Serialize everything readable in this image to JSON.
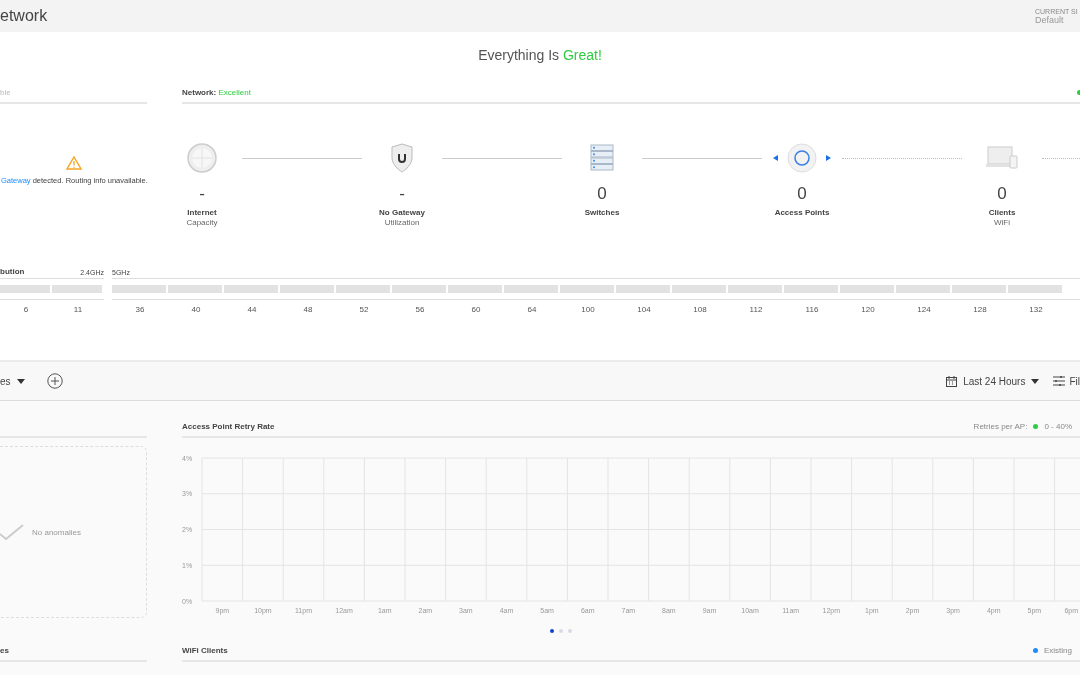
{
  "header": {
    "title": "etwork",
    "site_label": "CURRENT SI",
    "site_value": "Default"
  },
  "status": {
    "text": "Everything Is",
    "highlight": "Great!"
  },
  "left_panel": {
    "title": "ble",
    "message_link": "Gateway",
    "message": "detected. Routing info unavailable."
  },
  "network": {
    "label": "Network:",
    "rating": "Excellent"
  },
  "topology": [
    {
      "kind": "internet",
      "value": "-",
      "label": "Internet",
      "sublabel": "Capacity",
      "wireless": false
    },
    {
      "kind": "gateway",
      "value": "-",
      "label": "No Gateway",
      "sublabel": "Utilization",
      "wireless": false
    },
    {
      "kind": "switch",
      "value": "0",
      "label": "Switches",
      "wireless": false
    },
    {
      "kind": "access_point",
      "value": "0",
      "label": "Access Points",
      "wireless": true
    },
    {
      "kind": "client",
      "value": "0",
      "label": "Clients",
      "sublabel": "WiFi",
      "wireless": true
    }
  ],
  "channel_distribution": {
    "title": "bution",
    "bands": [
      {
        "name": "2.4GHz",
        "channels": [
          "6",
          "11"
        ]
      },
      {
        "name": "5GHz",
        "channels": [
          "36",
          "40",
          "44",
          "48",
          "52",
          "56",
          "60",
          "64",
          "100",
          "104",
          "108",
          "112",
          "116",
          "120",
          "124",
          "128",
          "132"
        ]
      }
    ]
  },
  "toolbar": {
    "view": "es",
    "range": "Last 24 Hours",
    "filter": "Fil"
  },
  "anomalies": {
    "message": "No anomalies"
  },
  "retry_chart": {
    "title": "Access Point Retry Rate",
    "legend_label": "Retries per AP:",
    "chart_data": {
      "type": "line",
      "categories": [
        "9pm",
        "10pm",
        "11pm",
        "12am",
        "1am",
        "2am",
        "3am",
        "4am",
        "5am",
        "6am",
        "7am",
        "8am",
        "9am",
        "10am",
        "11am",
        "12pm",
        "1pm",
        "2pm",
        "3pm",
        "4pm",
        "5pm",
        "6pm"
      ],
      "series": [
        {
          "name": "0 - 40%",
          "color": "#2ecc40",
          "values": [
            null,
            null,
            null,
            null,
            null,
            null,
            null,
            null,
            null,
            null,
            null,
            null,
            null,
            null,
            null,
            null,
            null,
            null,
            null,
            null,
            null,
            null
          ]
        }
      ],
      "grid": true,
      "ylim": [
        0,
        4
      ],
      "yticks": [
        {
          "value": 0,
          "label": "0%"
        },
        {
          "value": 1,
          "label": "1%"
        },
        {
          "value": 2,
          "label": "2%"
        },
        {
          "value": 3,
          "label": "3%"
        },
        {
          "value": 4,
          "label": "4%"
        }
      ]
    },
    "pages": [
      {
        "selected": true
      },
      {
        "selected": false
      },
      {
        "selected": false
      }
    ]
  },
  "bottom": {
    "left_title": "es",
    "wifi_title": "WiFi Clients",
    "legend": [
      {
        "label": "Existing",
        "color": "#1a8cff"
      }
    ]
  }
}
